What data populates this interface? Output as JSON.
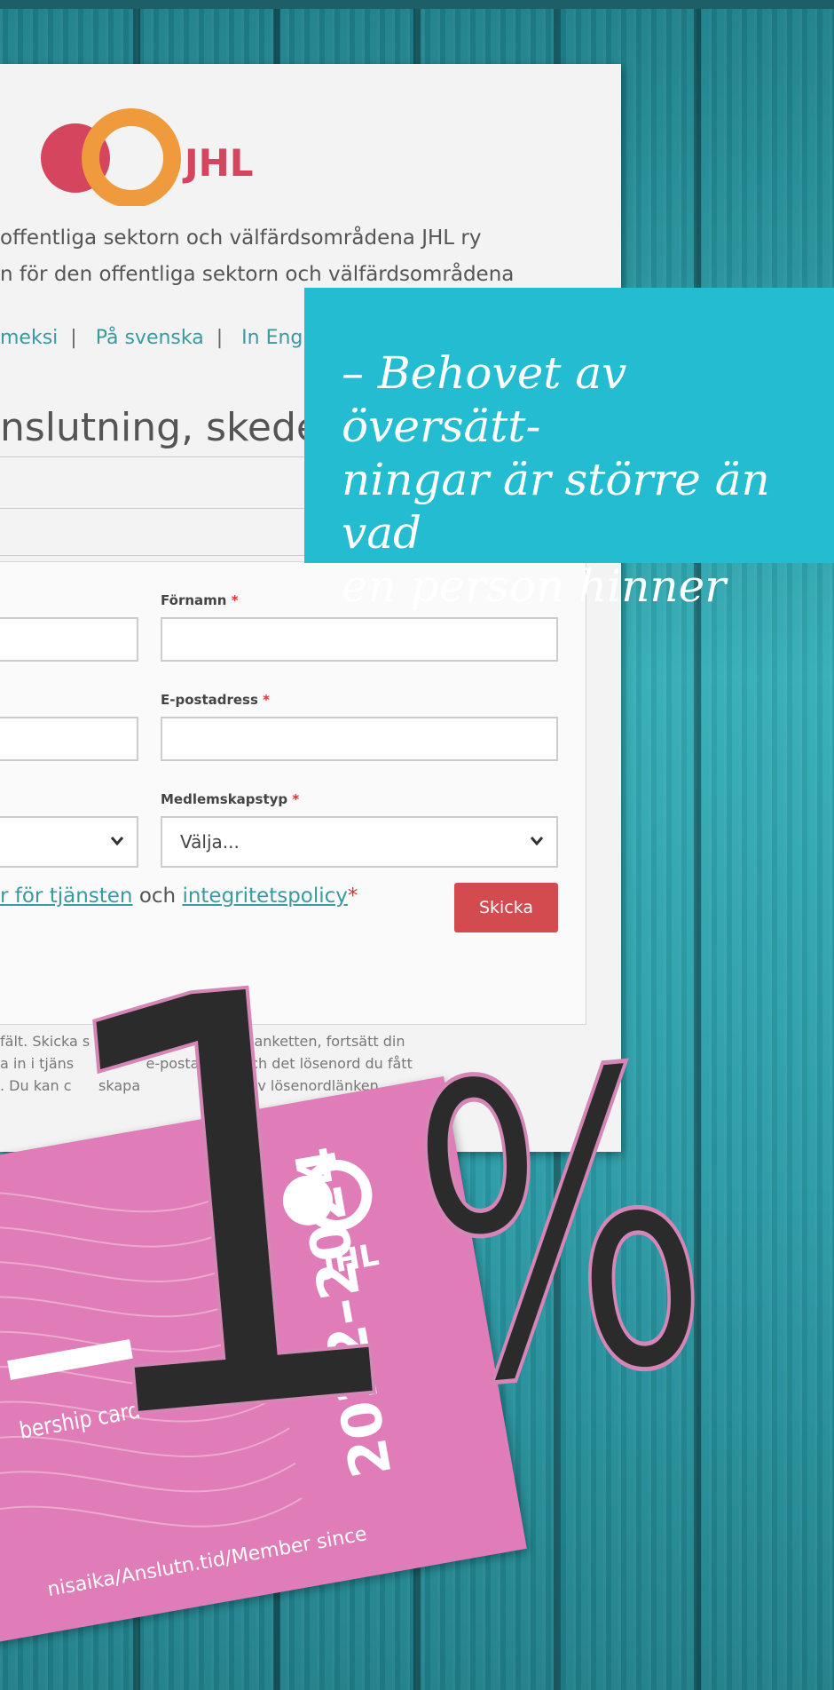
{
  "form": {
    "org_line_1": "offentliga sektorn och välfärdsområdena JHL ry",
    "org_line_2": "n för den offentliga sektorn och välfärdsområdena",
    "logo_text": "JHL",
    "languages": [
      "meksi",
      "På svenska",
      "In Engl"
    ],
    "heading": "nslutning, skede",
    "fields": {
      "firstname_label": "Förnamn",
      "email_label": "E-postadress",
      "membership_label": "Medlemskapstyp",
      "membership_value": "Välja..."
    },
    "required_mark": "*",
    "terms": {
      "link1": "r för tjänsten",
      "middle": " och ",
      "link2": "integritetspolicy",
      "req": "*"
    },
    "submit_label": "Skicka",
    "footnote": "fält. Skicka s          När du skickat blanketten, fortsätt din\na in i tjäns                e-postadress och det lösenord du fått\n. Du kan c      skapa                          v lösenordlänken"
  },
  "quote": {
    "text": "– Behovet av översätt-\nningar är större än vad\nen person hinner med."
  },
  "card": {
    "logo_text": "JHL",
    "title": "bership card",
    "years": "2022–2024",
    "since": "nisaika/Anslutn.tid/Member since"
  },
  "headline": {
    "one": "1",
    "percent": "%"
  },
  "colors": {
    "quote_bg": "#23bcd1",
    "card_pink": "#e07cb7",
    "button_red": "#d34a4f",
    "link_teal": "#3a9aa0"
  }
}
